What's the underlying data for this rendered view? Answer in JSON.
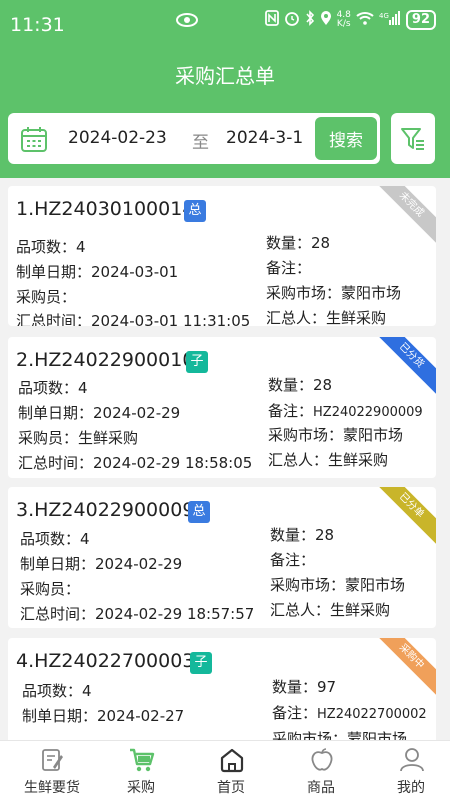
{
  "status_bar": {
    "time": "11:31",
    "network_speed": "4.8\nK/s",
    "signal_text": "4G",
    "battery": "92"
  },
  "header": {
    "title": "采购汇总单"
  },
  "search": {
    "start_date": "2024-02-23",
    "to_label": "至",
    "end_date": "2024-3-1",
    "search_button": "搜索"
  },
  "orders": [
    {
      "title": "1.HZ24030100014",
      "tag": "总",
      "tag_color": "#3a7be0",
      "status": "未完成",
      "status_color": "#c8c8c8",
      "item_count_label": "品项数：",
      "item_count": "4",
      "qty_label": "数量：",
      "qty": "28",
      "date_label": "制单日期：",
      "date": "2024-03-01",
      "remark_label": "备注：",
      "remark": "",
      "buyer_label": "采购员：",
      "buyer": "",
      "market_label": "采购市场：",
      "market": "蒙阳市场",
      "summary_time_label": "汇总时间：",
      "summary_time": "2024-03-01 11:31:05",
      "summarizer_label": "汇总人：",
      "summarizer": "生鲜采购"
    },
    {
      "title": "2.HZ24022900010",
      "tag": "子",
      "tag_color": "#14b89b",
      "status": "已分货",
      "status_color": "#2f6fe0",
      "item_count_label": "品项数：",
      "item_count": "4",
      "qty_label": "数量：",
      "qty": "28",
      "date_label": "制单日期：",
      "date": "2024-02-29",
      "remark_label": "备注：",
      "remark": "HZ24022900009",
      "buyer_label": "采购员：",
      "buyer": "生鲜采购",
      "market_label": "采购市场：",
      "market": "蒙阳市场",
      "summary_time_label": "汇总时间：",
      "summary_time": "2024-02-29 18:58:05",
      "summarizer_label": "汇总人：",
      "summarizer": "生鲜采购"
    },
    {
      "title": "3.HZ24022900009",
      "tag": "总",
      "tag_color": "#3a7be0",
      "status": "已分单",
      "status_color": "#c9b52a",
      "item_count_label": "品项数：",
      "item_count": "4",
      "qty_label": "数量：",
      "qty": "28",
      "date_label": "制单日期：",
      "date": "2024-02-29",
      "remark_label": "备注：",
      "remark": "",
      "buyer_label": "采购员：",
      "buyer": "",
      "market_label": "采购市场：",
      "market": "蒙阳市场",
      "summary_time_label": "汇总时间：",
      "summary_time": "2024-02-29 18:57:57",
      "summarizer_label": "汇总人：",
      "summarizer": "生鲜采购"
    },
    {
      "title": "4.HZ24022700003",
      "tag": "子",
      "tag_color": "#14b89b",
      "status": "采购中",
      "status_color": "#f0a05a",
      "item_count_label": "品项数：",
      "item_count": "4",
      "qty_label": "数量：",
      "qty": "97",
      "date_label": "制单日期：",
      "date": "2024-02-27",
      "remark_label": "备注：",
      "remark": "HZ24022700002",
      "market_label": "采购市场：",
      "market": "蒙阳市场"
    }
  ],
  "tabs": [
    {
      "label": "生鲜要货",
      "icon": "edit-note-icon"
    },
    {
      "label": "采购",
      "icon": "cart-icon"
    },
    {
      "label": "首页",
      "icon": "home-icon"
    },
    {
      "label": "商品",
      "icon": "product-icon"
    },
    {
      "label": "我的",
      "icon": "user-icon"
    }
  ],
  "colors": {
    "brand": "#5dc26a",
    "background": "#f2f2f2"
  }
}
